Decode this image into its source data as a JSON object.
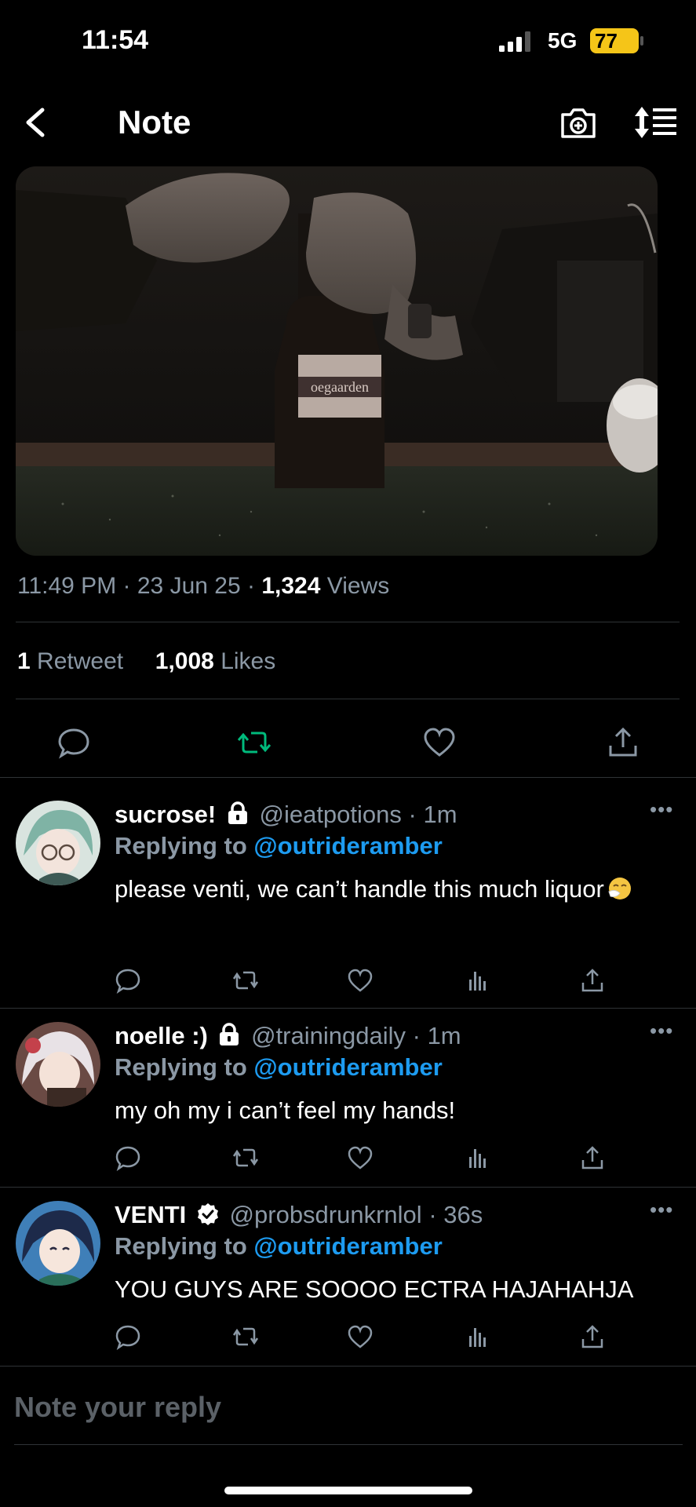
{
  "status_bar": {
    "time": "11:54",
    "network": "5G",
    "battery": "77"
  },
  "header": {
    "title": "Note",
    "back_icon": "chevron-left-icon",
    "camera_icon": "camera-add-icon",
    "sort_icon": "sort-list-icon"
  },
  "post": {
    "time": "11:49 PM",
    "date": "23 Jun 25",
    "views_count": "1,324",
    "views_label": "Views",
    "bottle_label": "oegaarden",
    "retweets_count": "1",
    "retweets_label": "Retweet",
    "likes_count": "1,008",
    "likes_label": "Likes",
    "retweet_active_color": "#00ba7c"
  },
  "replies": [
    {
      "name": "sucrose!",
      "handle": "@ieatpotions",
      "time": "1m",
      "replying_prefix": "Replying to",
      "replying_to": "@outrideramber",
      "text": "please venti, we can’t handle this much liquor",
      "emoji_icon": "sneezing-face-emoji",
      "locked": true,
      "verified": false
    },
    {
      "name": "noelle :)",
      "handle": "@trainingdaily",
      "time": "1m",
      "replying_prefix": "Replying to",
      "replying_to": "@outrideramber",
      "text": "my oh my i can’t feel my hands!",
      "locked": true,
      "verified": false
    },
    {
      "name": "VENTI",
      "handle": "@probsdrunkrnlol",
      "time": "36s",
      "replying_prefix": "Replying to",
      "replying_to": "@outrideramber",
      "text": "YOU GUYS ARE SOOOO ECTRA HAJAHAHJA",
      "locked": false,
      "verified": true
    }
  ],
  "compose": {
    "placeholder": "Note your reply"
  },
  "colors": {
    "background": "#000000",
    "accent": "#1d9bf0",
    "muted": "#8b98a5",
    "battery": "#f5c518"
  }
}
